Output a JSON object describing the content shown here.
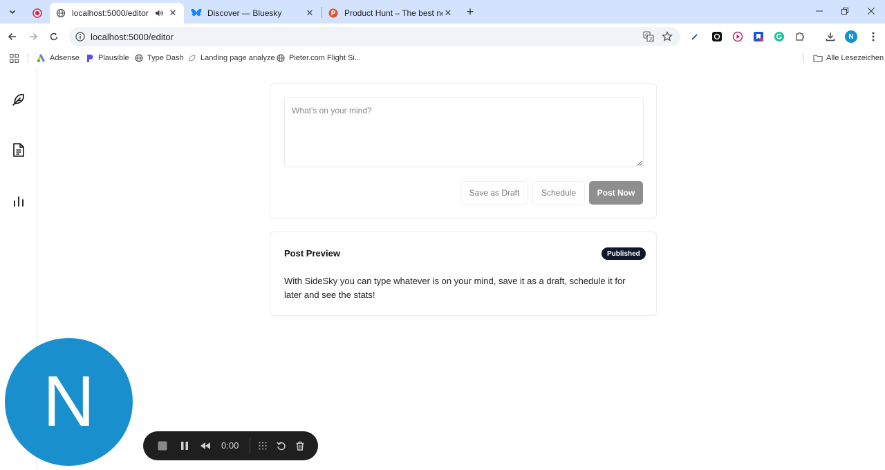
{
  "browser": {
    "tabs": [
      {
        "title": "localhost:5000/editor",
        "active": true
      },
      {
        "title": "Discover — Bluesky",
        "active": false
      },
      {
        "title": "Product Hunt – The best new p",
        "active": false
      }
    ],
    "url": "localhost:5000/editor",
    "profile_initial": "N",
    "bookmarks": [
      {
        "label": "Adsense"
      },
      {
        "label": "Plausible"
      },
      {
        "label": "Type Dash"
      },
      {
        "label": "Landing page analyze"
      },
      {
        "label": "Pieter.com Flight Si..."
      }
    ],
    "all_bookmarks_label": "Alle Lesezeichen"
  },
  "composer": {
    "placeholder": "What's on your mind?",
    "save_draft_label": "Save as Draft",
    "schedule_label": "Schedule",
    "post_now_label": "Post Now"
  },
  "preview": {
    "title": "Post Preview",
    "status": "Published",
    "body": "With SideSky you can type whatever is on your mind, save it as a draft, schedule it for later and see the stats!"
  },
  "overlay": {
    "avatar_initial": "N",
    "recorder_time": "0:00"
  },
  "colors": {
    "tabstrip_bg": "#d3e3fd",
    "avatar_bg": "#1a8fce",
    "badge_bg": "#0f172a",
    "post_button_bg": "#8f8f8f"
  }
}
